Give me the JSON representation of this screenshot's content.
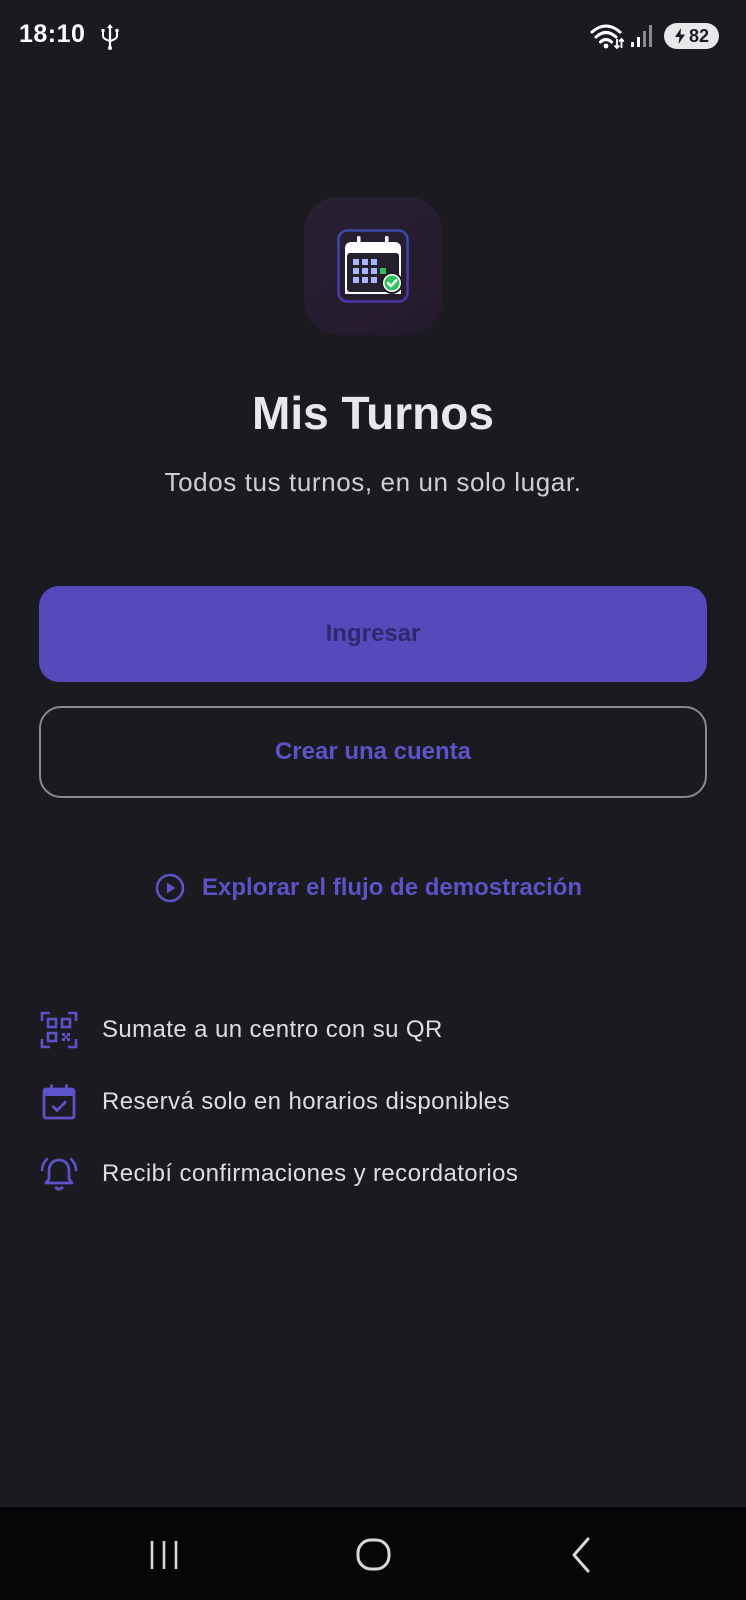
{
  "status_bar": {
    "time": "18:10",
    "battery_level": "82",
    "icons": [
      "usb-icon",
      "wifi-icon",
      "signal-icon",
      "battery-icon"
    ]
  },
  "app": {
    "icon": "calendar-check-icon",
    "title": "Mis Turnos",
    "subtitle": "Todos tus turnos, en un solo lugar."
  },
  "actions": {
    "login_label": "Ingresar",
    "signup_label": "Crear una cuenta",
    "demo_label": "Explorar el flujo de demostración",
    "demo_icon": "play-circle-icon"
  },
  "features": [
    {
      "icon": "qr-code-icon",
      "label": "Sumate a un centro con su QR"
    },
    {
      "icon": "calendar-check-icon",
      "label": "Reservá solo en horarios disponibles"
    },
    {
      "icon": "alarm-bell-icon",
      "label": "Recibí confirmaciones y recordatorios"
    }
  ],
  "nav_bar": {
    "buttons": [
      "recents-icon",
      "home-icon",
      "back-icon"
    ]
  },
  "colors": {
    "background": "#1a1a20",
    "accent": "#5549bb",
    "accent_text": "#5d52c8",
    "primary_button_text": "#2f2870",
    "text": "#e8e6ee"
  }
}
